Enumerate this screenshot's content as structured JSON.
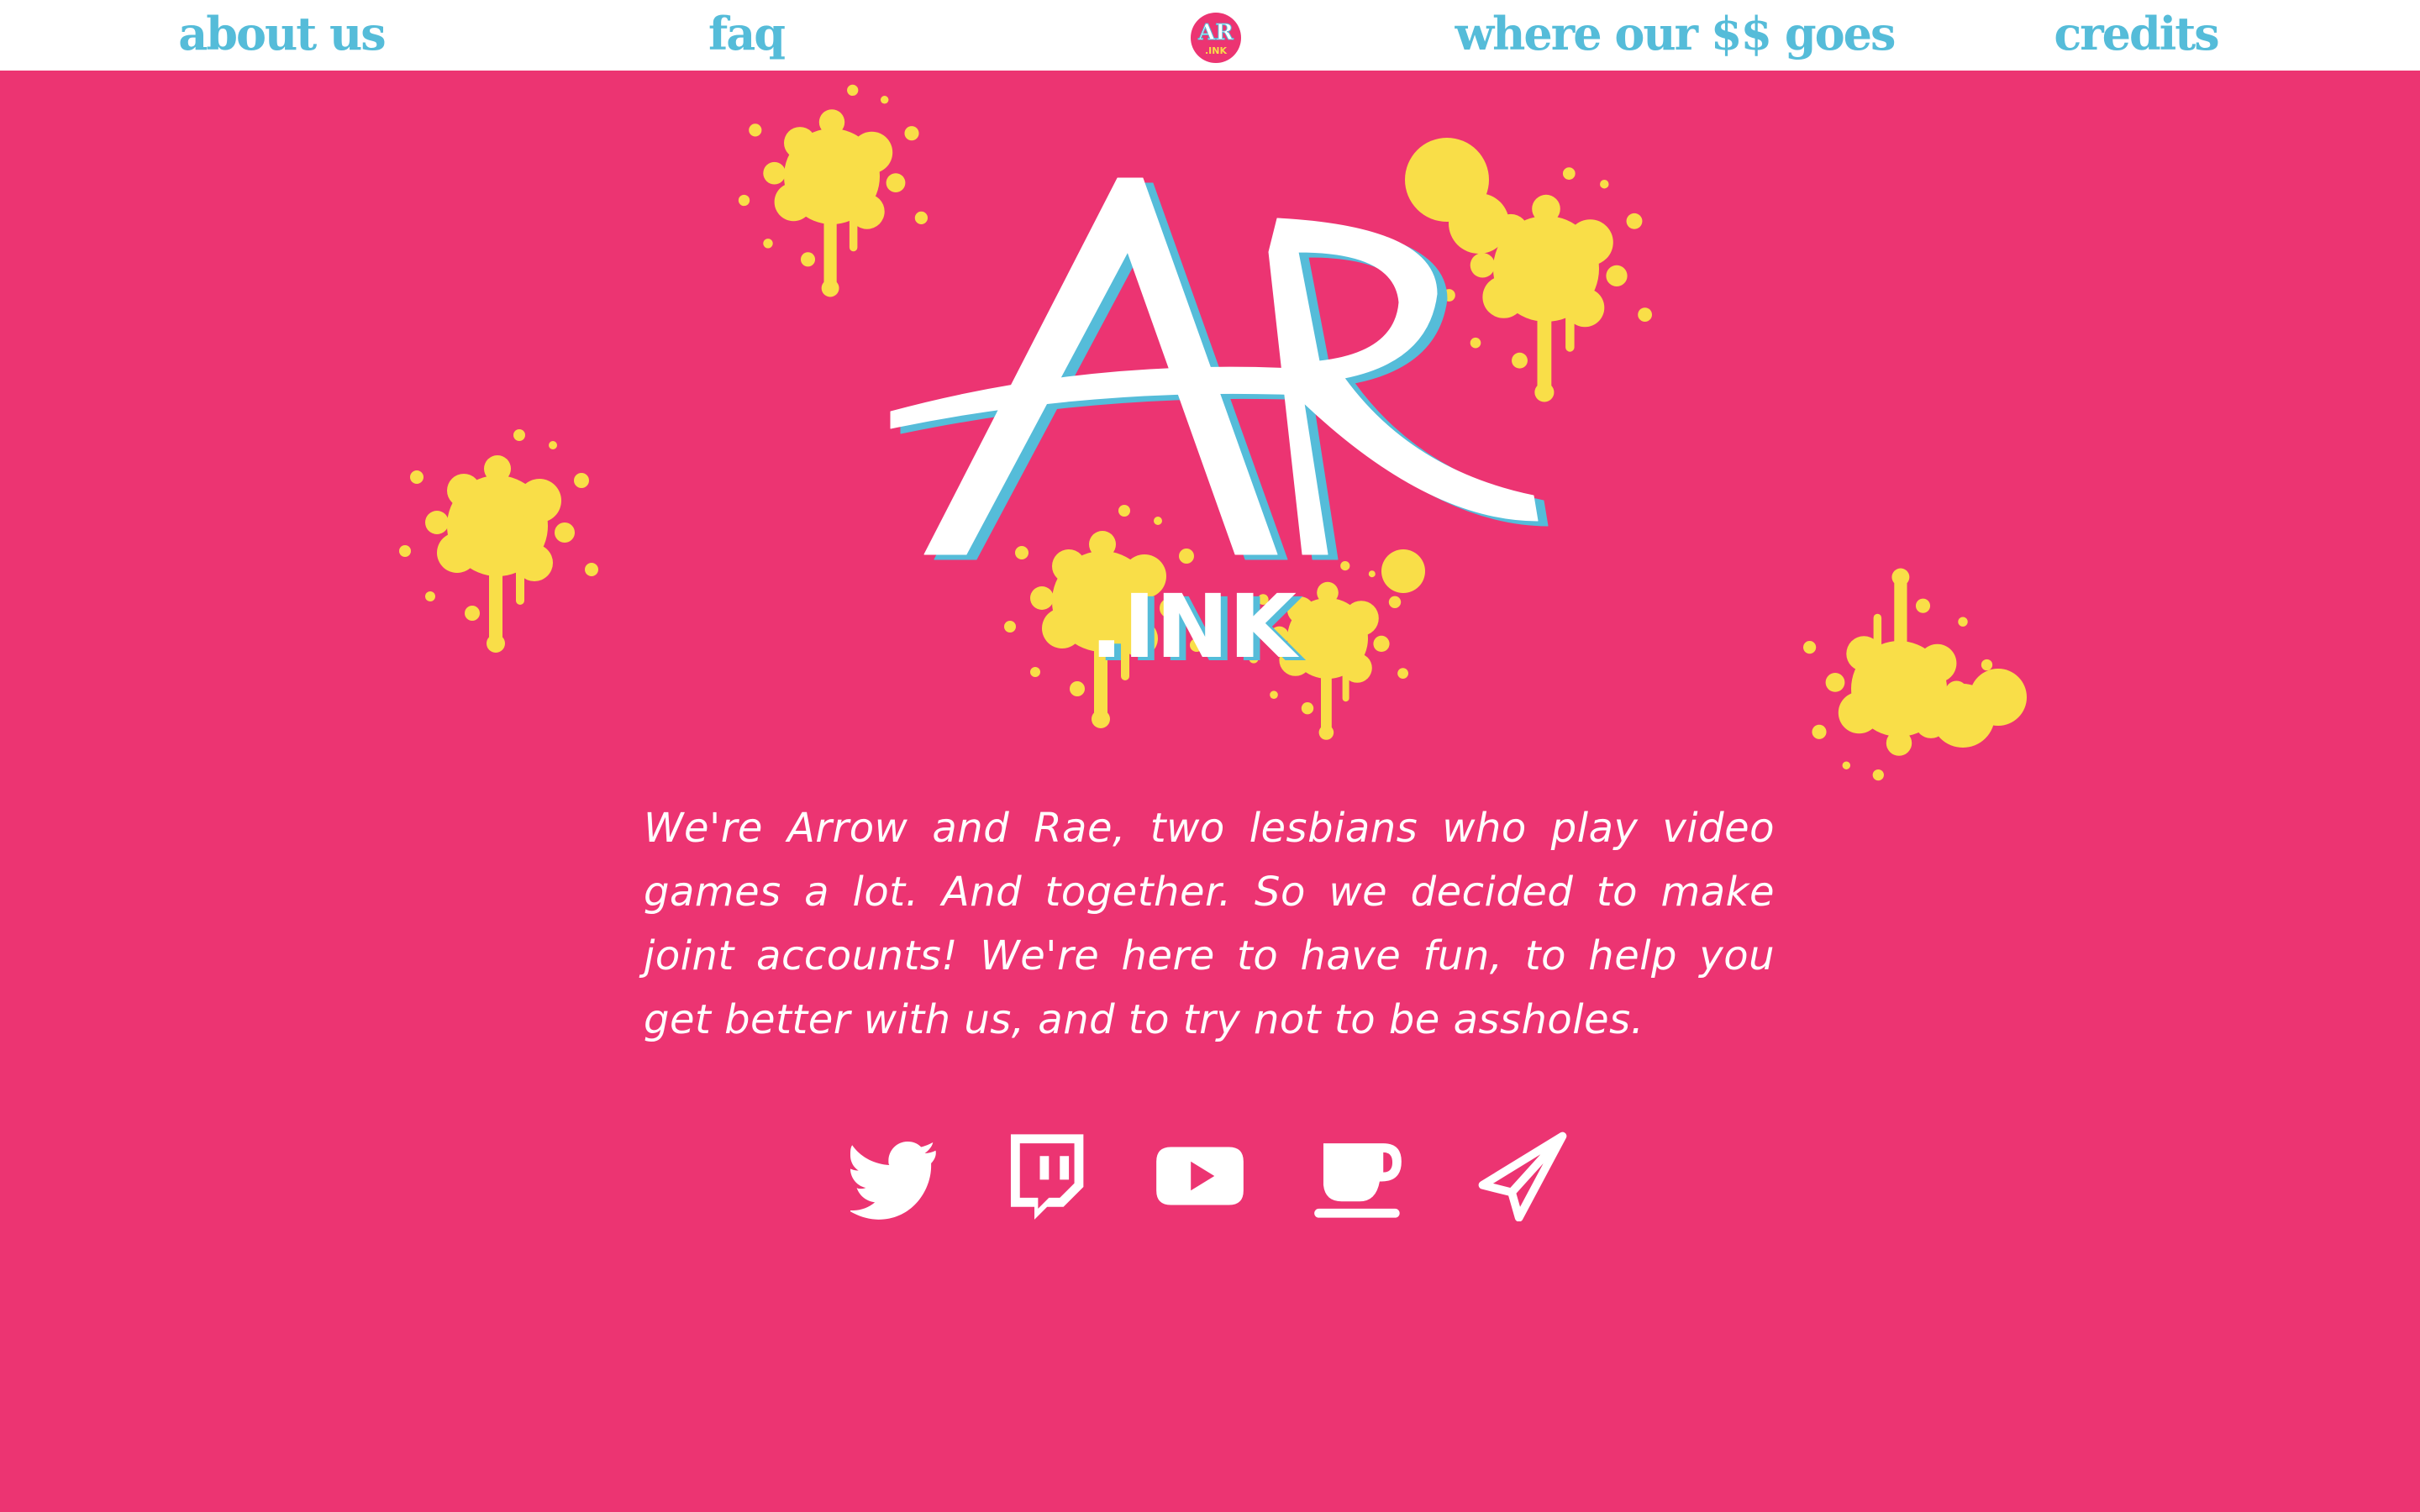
{
  "nav": {
    "items": [
      {
        "label": "about us"
      },
      {
        "label": "faq"
      },
      {
        "label": "where our $$ goes"
      },
      {
        "label": "credits"
      }
    ],
    "logo_icon": "ar-ink-logo-icon"
  },
  "hero": {
    "logo_letters": "AR",
    "logo_suffix": ".INK",
    "decoration_icon": "paint-splatter-icon"
  },
  "intro": {
    "text": "We're Arrow and Rae, two lesbians who play video games a lot. And together. So we decided to make joint accounts! We're here to have fun, to help you get better with us, and to try not to be assholes."
  },
  "social": [
    {
      "icon": "twitter-icon"
    },
    {
      "icon": "twitch-icon"
    },
    {
      "icon": "youtube-icon"
    },
    {
      "icon": "ko-fi-cup-icon"
    },
    {
      "icon": "telegram-icon"
    }
  ],
  "colors": {
    "background": "#EC3472",
    "nav_background": "#FFFFFF",
    "nav_text": "#55BCD9",
    "splatter": "#F9DE48",
    "logo_fill": "#FFFFFF",
    "logo_shadow": "#55BCD9",
    "text": "#FFFFFF"
  }
}
